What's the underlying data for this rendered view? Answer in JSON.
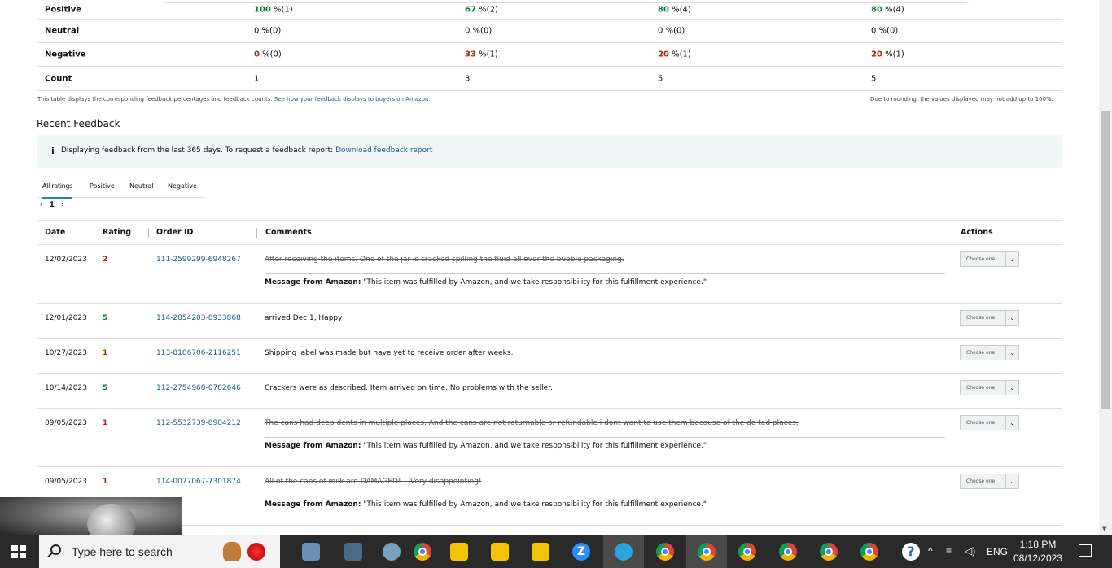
{
  "summary": {
    "rows": [
      {
        "label": "Positive",
        "cells": [
          {
            "pct": "100",
            "rest": " %(1)"
          },
          {
            "pct": "67",
            "rest": " %(2)"
          },
          {
            "pct": "80",
            "rest": " %(4)"
          },
          {
            "pct": "80",
            "rest": " %(4)"
          }
        ],
        "pct_color": "green"
      },
      {
        "label": "Neutral",
        "cells": [
          {
            "pct": "0",
            "rest": " %(0)"
          },
          {
            "pct": "0",
            "rest": " %(0)"
          },
          {
            "pct": "0",
            "rest": " %(0)"
          },
          {
            "pct": "0",
            "rest": " %(0)"
          }
        ],
        "pct_color": "none"
      },
      {
        "label": "Negative",
        "cells": [
          {
            "pct": "0",
            "rest": " %(0)"
          },
          {
            "pct": "33",
            "rest": " %(1)"
          },
          {
            "pct": "20",
            "rest": " %(1)"
          },
          {
            "pct": "20",
            "rest": " %(1)"
          }
        ],
        "pct_color": "red"
      },
      {
        "label": "Count",
        "cells": [
          {
            "pct": "1",
            "rest": ""
          },
          {
            "pct": "3",
            "rest": ""
          },
          {
            "pct": "5",
            "rest": ""
          },
          {
            "pct": "5",
            "rest": ""
          }
        ],
        "pct_color": "count"
      }
    ],
    "note_left": "This table displays the corresponding feedback percentages and feedback counts.",
    "note_link": "See how your feedback displays to buyers on Amazon.",
    "note_right": "Due to rounding, the values displayed may not add up to 100%."
  },
  "recent": {
    "title": "Recent Feedback",
    "info_text": "Displaying feedback from the last 365 days. To request a feedback report:",
    "info_link": "Download feedback report",
    "tabs": [
      "All ratings",
      "Positive",
      "Neutral",
      "Negative"
    ],
    "pager": {
      "prev": "‹",
      "page": "1",
      "next": "›"
    },
    "columns": {
      "date": "Date",
      "rating": "Rating",
      "order": "Order ID",
      "comments": "Comments",
      "actions": "Actions"
    },
    "select_label": "Choose one",
    "message_label": "Message from Amazon:",
    "message_text": "\"This item was fulfilled by Amazon, and we take responsibility for this fulfillment experience.\"",
    "rows": [
      {
        "date": "12/02/2023",
        "rating": "2",
        "rating_color": "red",
        "order": "111-2599299-6948267",
        "comment": "After receiving the items. One of the jar is cracked spilling the fluid all over the bubble packaging.",
        "strike": true
      },
      {
        "date": "12/01/2023",
        "rating": "5",
        "rating_color": "green",
        "order": "114-2854203-8933868",
        "comment": "arrived Dec 1, Happy",
        "strike": false
      },
      {
        "date": "10/27/2023",
        "rating": "1",
        "rating_color": "red",
        "order": "113-8186706-2116251",
        "comment": "Shipping label was made but have yet to receive order after weeks.",
        "strike": false
      },
      {
        "date": "10/14/2023",
        "rating": "5",
        "rating_color": "green",
        "order": "112-2754968-0782646",
        "comment": "Crackers were as described. Item arrived on time. No problems with the seller.",
        "strike": false
      },
      {
        "date": "09/05/2023",
        "rating": "1",
        "rating_color": "red",
        "order": "112-5532739-8984212",
        "comment": "The cans had deep dents in multiple places. And the cans are not returnable or refundable i dont want to use them because of the de ted places.",
        "strike": true
      },
      {
        "date": "09/05/2023",
        "rating": "1",
        "rating_color": "red",
        "order": "114-0077067-7301874",
        "comment": "All of the cans of milk are DAMAGED!... Very disappointing!",
        "strike": true
      }
    ]
  },
  "taskbar": {
    "search_placeholder": "Type here to search",
    "lang": "ENG",
    "time": "1:18 PM",
    "date": "08/12/2023"
  },
  "colors": {
    "green": "#067d30",
    "red": "#b12704",
    "link": "#1a5e8a",
    "accent": "#1a8f8f"
  }
}
